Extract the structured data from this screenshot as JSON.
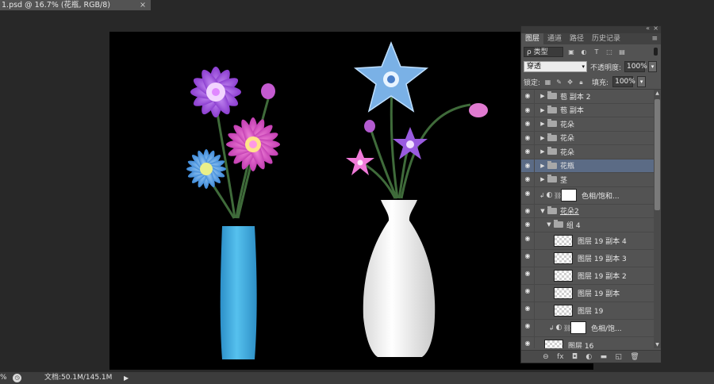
{
  "document_tab": {
    "title": "1.psd @ 16.7% (花瓶, RGB/8)",
    "close": "×"
  },
  "panel": {
    "collapse_icon": "«",
    "close_icon": "×",
    "tabs": [
      "图层",
      "通道",
      "路径",
      "历史记录"
    ],
    "menu_icon": "≡",
    "filter": {
      "search_icon": "ρ",
      "kind": "类型",
      "icons": [
        "image-filter-icon",
        "adjustment-filter-icon",
        "type-filter-icon",
        "shape-filter-icon",
        "smart-object-filter-icon"
      ]
    },
    "blend_mode": "穿透",
    "opacity_label": "不透明度:",
    "opacity_value": "100%",
    "lock_label": "锁定:",
    "fill_label": "填充:",
    "fill_value": "100%",
    "layers": [
      {
        "name": "苞 副本 2",
        "type": "group",
        "indent": 0,
        "selected": false
      },
      {
        "name": "苞 副本",
        "type": "group",
        "indent": 0,
        "selected": false
      },
      {
        "name": "花朵",
        "type": "group",
        "indent": 0,
        "selected": false
      },
      {
        "name": "花朵",
        "type": "group",
        "indent": 0,
        "selected": false
      },
      {
        "name": "花朵",
        "type": "group",
        "indent": 0,
        "selected": false
      },
      {
        "name": "花瓶",
        "type": "group",
        "indent": 0,
        "selected": true
      },
      {
        "name": "茎",
        "type": "group",
        "indent": 0,
        "selected": false
      },
      {
        "name": "色相/饱和...",
        "type": "adjustment",
        "indent": 0,
        "selected": false
      },
      {
        "name": "花朵2",
        "type": "group-open",
        "indent": 0,
        "selected": false
      },
      {
        "name": "组 4",
        "type": "group-open",
        "indent": 1,
        "selected": false
      },
      {
        "name": "图层 19 副本 4",
        "type": "pixel",
        "indent": 2,
        "selected": false
      },
      {
        "name": "图层 19 副本 3",
        "type": "pixel",
        "indent": 2,
        "selected": false
      },
      {
        "name": "图层 19 副本 2",
        "type": "pixel",
        "indent": 2,
        "selected": false
      },
      {
        "name": "图层 19 副本",
        "type": "pixel",
        "indent": 2,
        "selected": false
      },
      {
        "name": "图层 19",
        "type": "pixel",
        "indent": 2,
        "selected": false
      },
      {
        "name": "色相/饱...",
        "type": "adjustment",
        "indent": 1,
        "selected": false
      },
      {
        "name": "图层 16",
        "type": "pixel",
        "indent": 1,
        "selected": false
      }
    ],
    "bottom_icons": [
      "link-layers-icon",
      "fx-icon",
      "add-mask-icon",
      "new-adjustment-icon",
      "new-group-icon",
      "new-layer-icon",
      "delete-layer-icon"
    ],
    "bottom_glyphs": [
      "⊖",
      "fx",
      "◘",
      "◐",
      "▬",
      "◱",
      "🗑"
    ]
  },
  "status_bar": {
    "zoom": "%",
    "doc_info": "文档:50.1M/145.1M",
    "arrow": "▶"
  },
  "colors": {
    "selected_layer": "#5b6b85",
    "panel_bg": "#535353",
    "canvas_bg": "#000000"
  }
}
